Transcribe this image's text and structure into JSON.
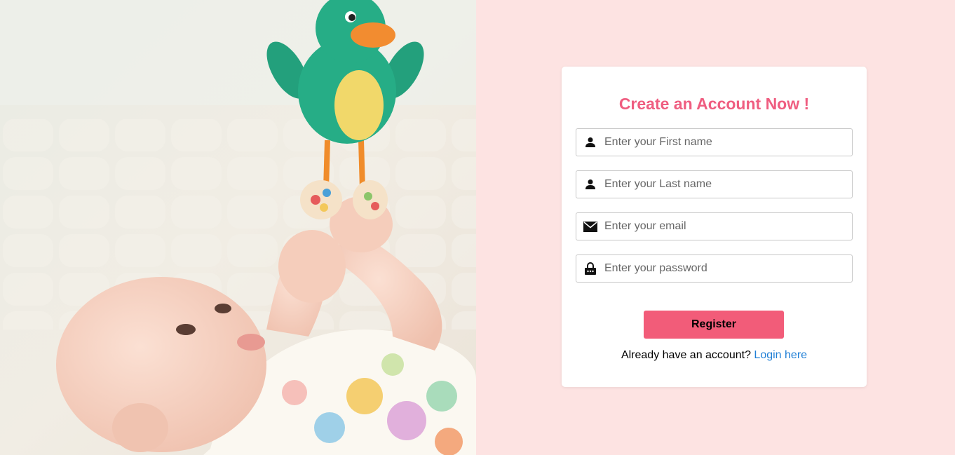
{
  "hero": {
    "image_icon": "baby-with-green-bird-toy-photo"
  },
  "form": {
    "title": "Create an Account Now !",
    "fields": [
      {
        "icon": "user-icon",
        "placeholder": "Enter your First name",
        "value": ""
      },
      {
        "icon": "user-icon",
        "placeholder": "Enter your Last name",
        "value": ""
      },
      {
        "icon": "envelope-icon",
        "placeholder": "Enter your email",
        "value": ""
      },
      {
        "icon": "lock-icon",
        "placeholder": "Enter your password",
        "value": ""
      }
    ],
    "register_label": "Register",
    "login_prompt": "Already have an account?",
    "login_link": "Login here"
  },
  "colors": {
    "accent": "#f25c79",
    "title": "#ef5d80",
    "panel_bg": "#fde3e2",
    "link": "#1f7fd6"
  }
}
